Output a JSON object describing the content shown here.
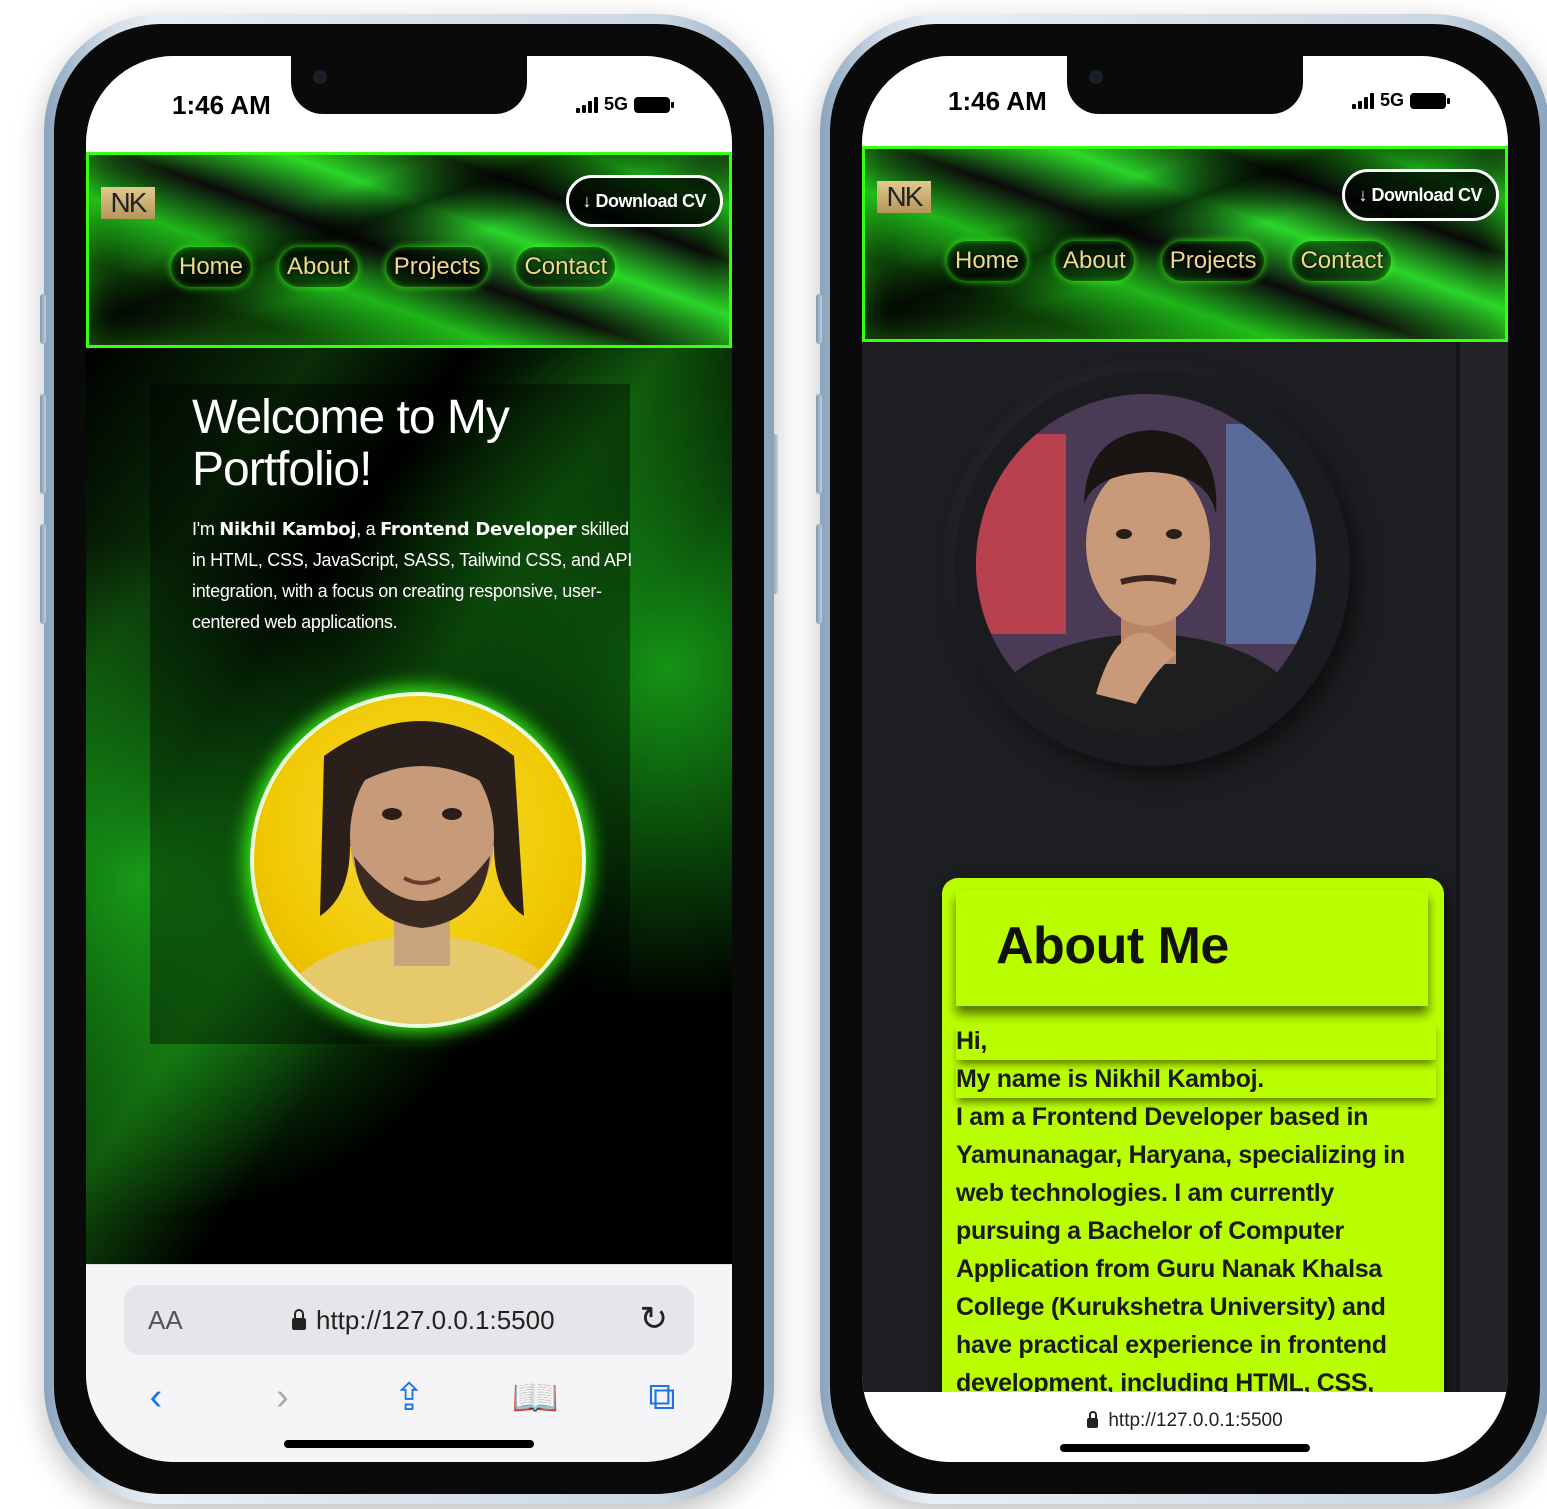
{
  "left_phone": {
    "status": {
      "time": "1:46 AM",
      "network": "5G"
    },
    "header": {
      "logo": "NK",
      "download_cv": "↓ Download CV",
      "nav": [
        "Home",
        "About",
        "Projects",
        "Contact"
      ]
    },
    "hero": {
      "title": "Welcome to My Portfolio!",
      "intro_prefix": "I'm ",
      "name": "Nikhil Kamboj",
      "intro_mid": ", a ",
      "role": "Frontend Developer",
      "intro_rest": " skilled in HTML, CSS, JavaScript, SASS, Tailwind CSS, and API integration, with a focus on creating responsive, user-centered web applications."
    },
    "browser": {
      "aa": "AA",
      "url": "http://127.0.0.1:5500",
      "reload_icon": "↻",
      "toolbar": [
        "‹",
        "›",
        "⇪",
        "📖",
        "⧉"
      ]
    }
  },
  "right_phone": {
    "status": {
      "time": "1:46 AM",
      "network": "5G"
    },
    "header": {
      "logo": "NK",
      "download_cv": "↓ Download CV",
      "nav": [
        "Home",
        "About",
        "Projects",
        "Contact"
      ]
    },
    "about": {
      "title": "About Me",
      "lines": [
        "Hi,",
        "My name is Nikhil Kamboj.",
        "I am a Frontend Developer based in",
        "Yamunanagar, Haryana, specializing in",
        "web technologies. I am currently",
        "pursuing a Bachelor of Computer",
        "Application from Guru Nanak Khalsa",
        "College (Kurukshetra University) and",
        "have practical experience in frontend",
        "development, including HTML, CSS,"
      ]
    },
    "browser": {
      "url": "http://127.0.0.1:5500"
    }
  },
  "colors": {
    "neon_green": "#39ff14",
    "lime": "#baff00",
    "gold": "#f0d98a",
    "ios_blue": "#1a73e8"
  }
}
